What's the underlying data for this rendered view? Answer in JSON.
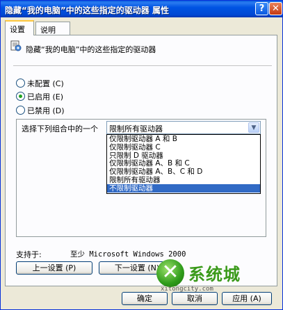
{
  "window": {
    "title": "隐藏“我的电脑”中的这些指定的驱动器 属性",
    "help_glyph": "?",
    "close_glyph": "✕"
  },
  "tabs": [
    {
      "label": "设置",
      "active": true
    },
    {
      "label": "说明",
      "active": false
    }
  ],
  "policy": {
    "icon": "policy-setting-icon",
    "title": "隐藏“我的电脑”中的这些指定的驱动器"
  },
  "radios": [
    {
      "label": "未配置 (C)",
      "checked": false
    },
    {
      "label": "已启用 (E)",
      "checked": true
    },
    {
      "label": "已禁用 (D)",
      "checked": false
    }
  ],
  "options": {
    "label": "选择下列组合中的一个",
    "selected_value": "限制所有驱动器",
    "dropdown_items": [
      {
        "label": "仅限制驱动器 A 和 B",
        "selected": false
      },
      {
        "label": "仅限制驱动器 C",
        "selected": false
      },
      {
        "label": "只限制 D 驱动器",
        "selected": false
      },
      {
        "label": "仅限制驱动器 A、B 和 C",
        "selected": false
      },
      {
        "label": "仅限制驱动器 A、B、C 和 D",
        "selected": false
      },
      {
        "label": "限制所有驱动器",
        "selected": false
      },
      {
        "label": "不限制驱动器",
        "selected": true
      }
    ]
  },
  "support": {
    "label": "支持于:",
    "value": "至少 Microsoft Windows 2000"
  },
  "buttons": {
    "prev": "上一设置 (P)",
    "next": "下一设置 (N)",
    "ok": "确定",
    "cancel": "取消",
    "apply": "应用 (A)"
  },
  "watermark": {
    "logo_glyph": "✕",
    "text": "系统城",
    "site": "xitongcity.com"
  },
  "colors": {
    "titlebar": "#0054E3",
    "dialog_bg": "#ECE9D8",
    "selection": "#316AC5",
    "tab_highlight": "#FFC73C"
  }
}
